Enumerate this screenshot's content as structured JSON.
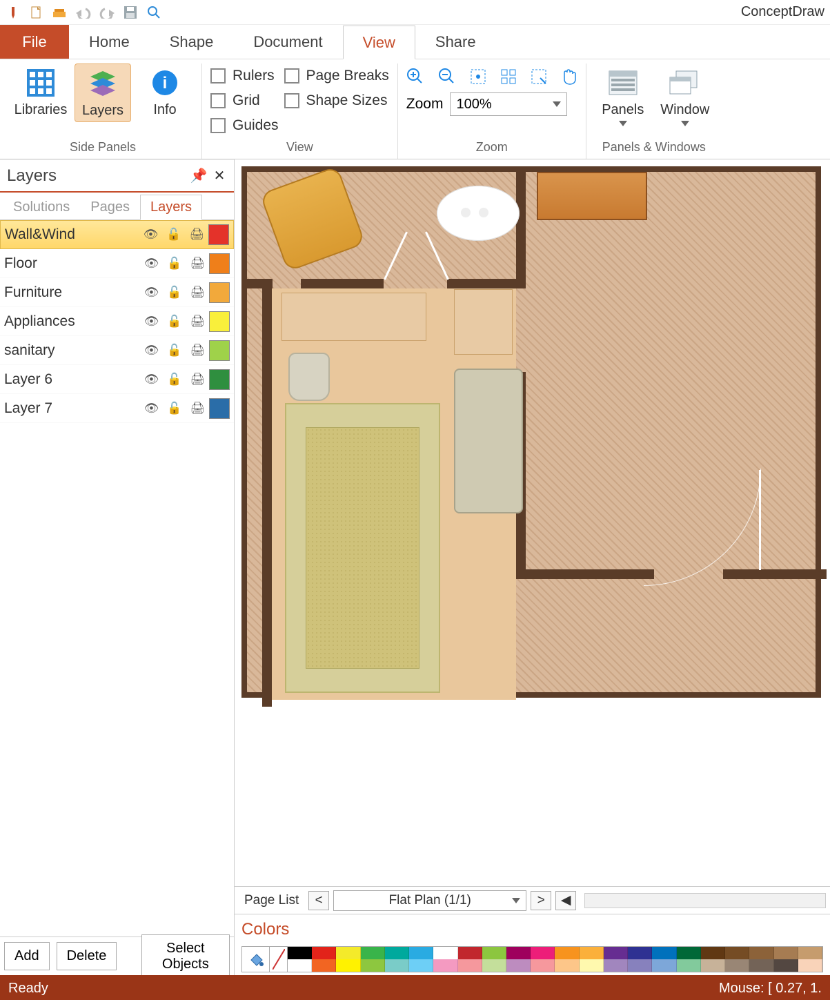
{
  "app": {
    "title": "ConceptDraw "
  },
  "qat_icons": [
    "pencil-icon",
    "new-file-icon",
    "open-icon",
    "undo-icon",
    "redo-icon",
    "save-icon",
    "find-icon"
  ],
  "tabs": {
    "file": "File",
    "items": [
      "Home",
      "Shape",
      "Document",
      "View",
      "Share"
    ],
    "active": "View"
  },
  "ribbon": {
    "side_panels": {
      "label": "Side Panels",
      "libraries": "Libraries",
      "layers": "Layers",
      "info": "Info"
    },
    "view": {
      "label": "View",
      "checks_col1": [
        "Rulers",
        "Grid",
        "Guides"
      ],
      "checks_col2": [
        "Page Breaks",
        "Shape Sizes"
      ]
    },
    "zoom": {
      "label": "Zoom",
      "zoom_label": "Zoom",
      "value": "100%"
    },
    "panels_windows": {
      "label": "Panels & Windows",
      "panels": "Panels",
      "window": "Window"
    }
  },
  "layers_panel": {
    "title": "Layers",
    "tabs": [
      "Solutions",
      "Pages",
      "Layers"
    ],
    "active_tab": "Layers",
    "rows": [
      {
        "name": "Wall&Wind",
        "color": "#e4322a",
        "selected": true
      },
      {
        "name": "Floor",
        "color": "#ef7f1a",
        "selected": false
      },
      {
        "name": "Furniture",
        "color": "#f2a93b",
        "selected": false
      },
      {
        "name": "Appliances",
        "color": "#f9ef3b",
        "selected": false
      },
      {
        "name": "sanitary",
        "color": "#9fd24a",
        "selected": false
      },
      {
        "name": "Layer 6",
        "color": "#2f8f3f",
        "selected": false
      },
      {
        "name": "Layer 7",
        "color": "#2a6da8",
        "selected": false
      }
    ],
    "buttons": {
      "add": "Add",
      "delete": "Delete",
      "select": "Select Objects"
    }
  },
  "page_nav": {
    "page_list": "Page List",
    "current": "Flat Plan (1/1)"
  },
  "colors": {
    "title": "Colors",
    "swatches_top": [
      "#000000",
      "#e2231a",
      "#f4ea2a",
      "#39b44a",
      "#00a99d",
      "#29abe2",
      "#ffffff",
      "#c1272d",
      "#8cc63f",
      "#9e005d",
      "#ed1e79",
      "#f7931e",
      "#fbb03b",
      "#662d91",
      "#2e3192",
      "#0071bc",
      "#006837",
      "#603813",
      "#754c24",
      "#8c6239",
      "#a67c52",
      "#c69c6d"
    ],
    "swatches_bot": [
      "#ffffff",
      "#f26522",
      "#fff200",
      "#8dc73f",
      "#7accc8",
      "#6dcff6",
      "#f49ac1",
      "#f5989d",
      "#c4df9b",
      "#bd8cbf",
      "#f6989d",
      "#fdc689",
      "#fff9ae",
      "#a186be",
      "#8781bd",
      "#7da7d9",
      "#82ca9c",
      "#c7b299",
      "#998675",
      "#736357",
      "#534741",
      "#f9d3b9"
    ]
  },
  "status": {
    "ready": "Ready",
    "mouse": "Mouse: [ 0.27, 1."
  }
}
